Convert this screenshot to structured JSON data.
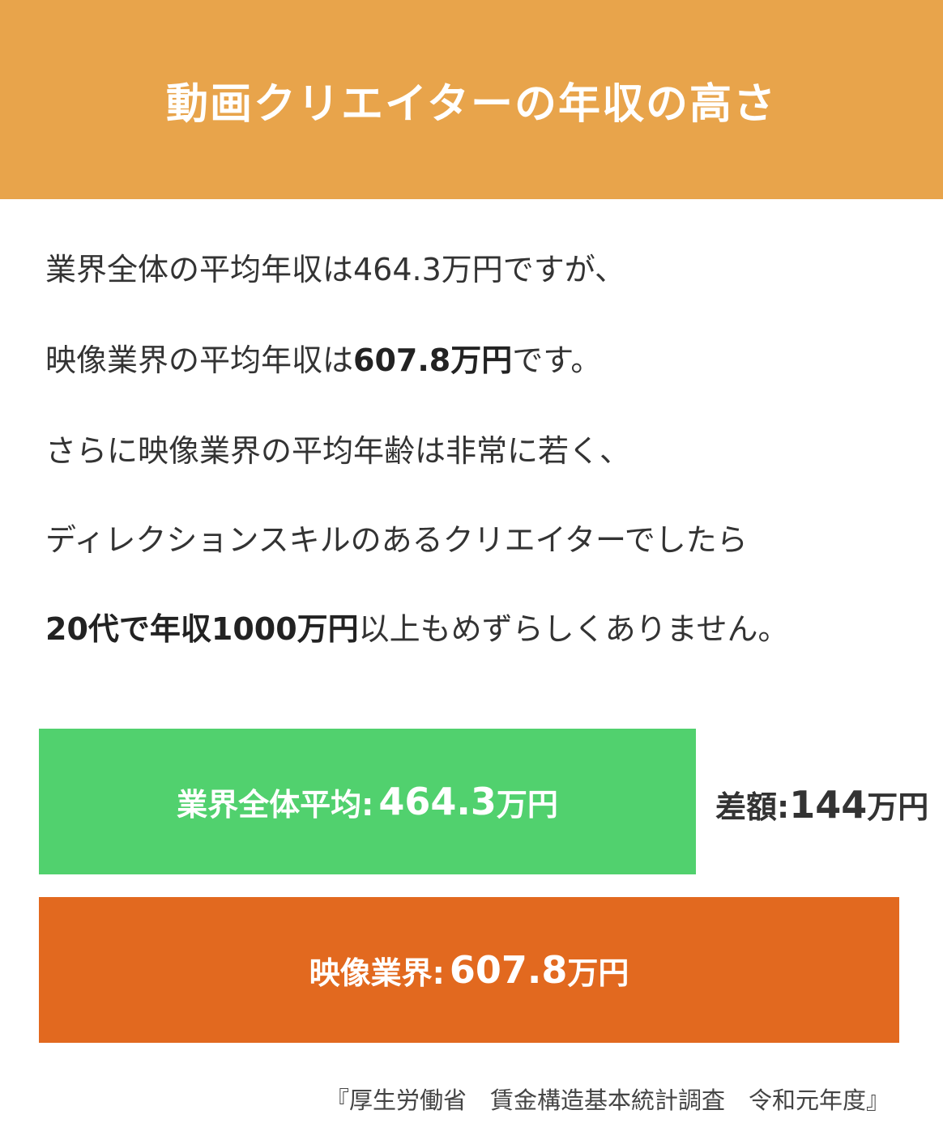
{
  "header": {
    "title": "動画クリエイターの年収の高さ",
    "bg_color": "#E8A44B"
  },
  "paragraphs": [
    {
      "parts": [
        {
          "text": "業界全体の平均年収は464.3万円ですが、",
          "bold": false
        }
      ]
    },
    {
      "parts": [
        {
          "text": "映像業界の平均年収は",
          "bold": false
        },
        {
          "text": "607.8万円",
          "bold": true
        },
        {
          "text": "です。",
          "bold": false
        }
      ]
    },
    {
      "parts": [
        {
          "text": "さらに映像業界の平均年齢は非常に若く、",
          "bold": false
        }
      ]
    },
    {
      "parts": [
        {
          "text": "ディレクションスキルのあるクリエイターでしたら",
          "bold": false
        }
      ]
    },
    {
      "parts": [
        {
          "text": "20代で年収1000万円",
          "bold": true
        },
        {
          "text": "以上もめずらしくありません。",
          "bold": false
        }
      ]
    }
  ],
  "chart_data": {
    "type": "bar",
    "orientation": "horizontal",
    "categories": [
      "業界全体平均",
      "映像業界"
    ],
    "values": [
      464.3,
      607.8
    ],
    "unit": "万円",
    "colors": [
      "#51D16E",
      "#E2691F"
    ],
    "bar_labels": [
      {
        "name": "業界全体平均:",
        "value": "464.3",
        "unit": "万円"
      },
      {
        "name": "映像業界:",
        "value": "607.8",
        "unit": "万円"
      }
    ],
    "annotation": {
      "label": "差額:",
      "value": "144",
      "unit": "万円"
    }
  },
  "source": "『厚生労働省　賃金構造基本統計調査　令和元年度』"
}
